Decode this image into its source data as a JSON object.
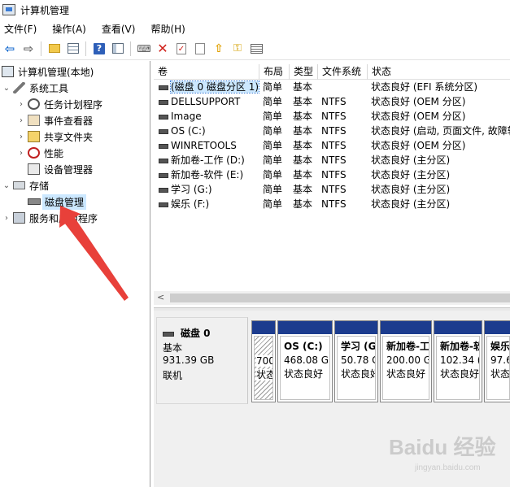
{
  "window": {
    "title": "计算机管理"
  },
  "menu": {
    "items": [
      "文件(F)",
      "操作(A)",
      "查看(V)",
      "帮助(H)"
    ]
  },
  "toolbar": {
    "buttons": [
      "back-icon",
      "forward-icon",
      "up-folder-icon",
      "show-tree-icon",
      "help-icon",
      "action-pane-icon",
      "connect-icon",
      "delete-icon",
      "properties-icon",
      "refresh-icon",
      "up-icon",
      "key-icon",
      "list-icon"
    ]
  },
  "tree": {
    "root": "计算机管理(本地)",
    "system_tools": "系统工具",
    "task_scheduler": "任务计划程序",
    "event_viewer": "事件查看器",
    "shared_folders": "共享文件夹",
    "performance": "性能",
    "device_manager": "设备管理器",
    "storage": "存储",
    "disk_management": "磁盘管理",
    "services": "服务和应用程序"
  },
  "volume_list": {
    "columns": [
      "卷",
      "布局",
      "类型",
      "文件系统",
      "状态"
    ],
    "rows": [
      {
        "name": "(磁盘 0 磁盘分区 1)",
        "layout": "简单",
        "type": "基本",
        "fs": "",
        "status": "状态良好 (EFI 系统分区)"
      },
      {
        "name": "DELLSUPPORT",
        "layout": "简单",
        "type": "基本",
        "fs": "NTFS",
        "status": "状态良好 (OEM 分区)"
      },
      {
        "name": "Image",
        "layout": "简单",
        "type": "基本",
        "fs": "NTFS",
        "status": "状态良好 (OEM 分区)"
      },
      {
        "name": "OS (C:)",
        "layout": "简单",
        "type": "基本",
        "fs": "NTFS",
        "status": "状态良好 (启动, 页面文件, 故障转"
      },
      {
        "name": "WINRETOOLS",
        "layout": "简单",
        "type": "基本",
        "fs": "NTFS",
        "status": "状态良好 (OEM 分区)"
      },
      {
        "name": "新加卷-工作 (D:)",
        "layout": "简单",
        "type": "基本",
        "fs": "NTFS",
        "status": "状态良好 (主分区)"
      },
      {
        "name": "新加卷-软件 (E:)",
        "layout": "简单",
        "type": "基本",
        "fs": "NTFS",
        "status": "状态良好 (主分区)"
      },
      {
        "name": "学习 (G:)",
        "layout": "简单",
        "type": "基本",
        "fs": "NTFS",
        "status": "状态良好 (主分区)"
      },
      {
        "name": "娱乐 (F:)",
        "layout": "简单",
        "type": "基本",
        "fs": "NTFS",
        "status": "状态良好 (主分区)"
      }
    ]
  },
  "disk": {
    "title": "磁盘 0",
    "type": "基本",
    "size": "931.39 GB",
    "state": "联机",
    "partitions": [
      {
        "name": "",
        "size": "700",
        "status": "状态",
        "hatched": true
      },
      {
        "name": "OS  (C:)",
        "size": "468.08 GI",
        "status": "状态良好"
      },
      {
        "name": "学习  (G",
        "size": "50.78 G",
        "status": "状态良好"
      },
      {
        "name": "新加卷-工",
        "size": "200.00 G",
        "status": "状态良好"
      },
      {
        "name": "新加卷-软",
        "size": "102.34 (",
        "status": "状态良好"
      },
      {
        "name": "娱乐",
        "size": "97.6(",
        "status": "状态良"
      }
    ]
  },
  "watermark": {
    "main": "Baidu 经验",
    "sub": "jingyan.baidu.com"
  },
  "colors": {
    "partition_bar": "#1c3c8e",
    "selection": "#cce8ff",
    "annotation_arrow": "#e8403a"
  }
}
